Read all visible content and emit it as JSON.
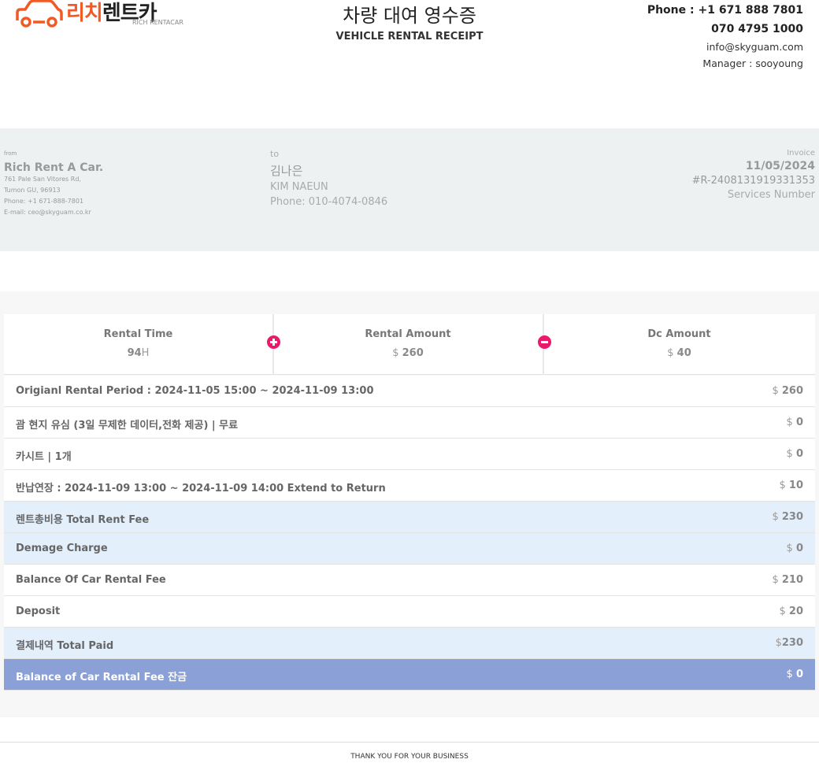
{
  "header": {
    "logo_ko_red": "리치",
    "logo_ko_dark": "렌트카",
    "logo_en": "RICH RENTACAR",
    "title_ko": "차량 대여 영수증",
    "title_en": "VEHICLE RENTAL RECEIPT",
    "phone1": "Phone : +1 671 888 7801",
    "phone2": "070 4795 1000",
    "email": "info@skyguam.com",
    "manager": "Manager : sooyoung"
  },
  "from": {
    "label": "from",
    "name": "Rich Rent A Car.",
    "address1": "761 Pale San Vitores Rd,",
    "address2": "Tumon GU, 96913",
    "phone": "Phone: +1 671-888-7801",
    "email": "E-mail: ceo@skyguam.co.kr"
  },
  "to": {
    "label": "to",
    "name_ko": "김나은",
    "name_en": "KIM NAEUN",
    "phone": "Phone: 010-4074-0846"
  },
  "invoice": {
    "label": "Invoice",
    "date": "11/05/2024",
    "number": "#R-2408131919331353",
    "services": "Services Number"
  },
  "summary": {
    "rental_time_label": "Rental Time",
    "rental_time_value": "94",
    "rental_time_unit": "H",
    "rental_amount_label": "Rental Amount",
    "rental_amount_currency": "$ ",
    "rental_amount_value": "260",
    "dc_amount_label": "Dc Amount",
    "dc_amount_currency": "$ ",
    "dc_amount_value": "40"
  },
  "rows": [
    {
      "label": "Origianl Rental Period : 2024-11-05 15:00 ~ 2024-11-09 13:00",
      "currency": "$ ",
      "value": "260"
    },
    {
      "label": "괌 현지 유심 (3일 무제한 데이터,전화 제공) | 무료",
      "currency": "$ ",
      "value": "0"
    },
    {
      "label": "카시트 | 1개",
      "currency": "$ ",
      "value": "0"
    },
    {
      "label": "반납연장 : 2024-11-09 13:00 ~ 2024-11-09 14:00 Extend to Return",
      "currency": "$ ",
      "value": "10"
    },
    {
      "label": "렌트총비용 Total Rent Fee",
      "currency": "$ ",
      "value": "230"
    },
    {
      "label": "Demage Charge",
      "currency": "$ ",
      "value": "0"
    },
    {
      "label": "Balance Of Car Rental Fee",
      "currency": "$ ",
      "value": "210"
    },
    {
      "label": "Deposit",
      "currency": "$ ",
      "value": "20"
    },
    {
      "label": "결제내역 Total Paid",
      "currency": "$",
      "value": "230"
    },
    {
      "label": "Balance of Car Rental Fee 잔금",
      "currency": "$ ",
      "value": "0"
    }
  ],
  "footer": {
    "text": "THANK YOU FOR YOUR BUSINESS"
  },
  "colors": {
    "brand_orange": "#f15a24",
    "accent_pink": "#ea1a6a",
    "row_highlight": "#e4effc",
    "row_total": "#8aa0d6"
  }
}
